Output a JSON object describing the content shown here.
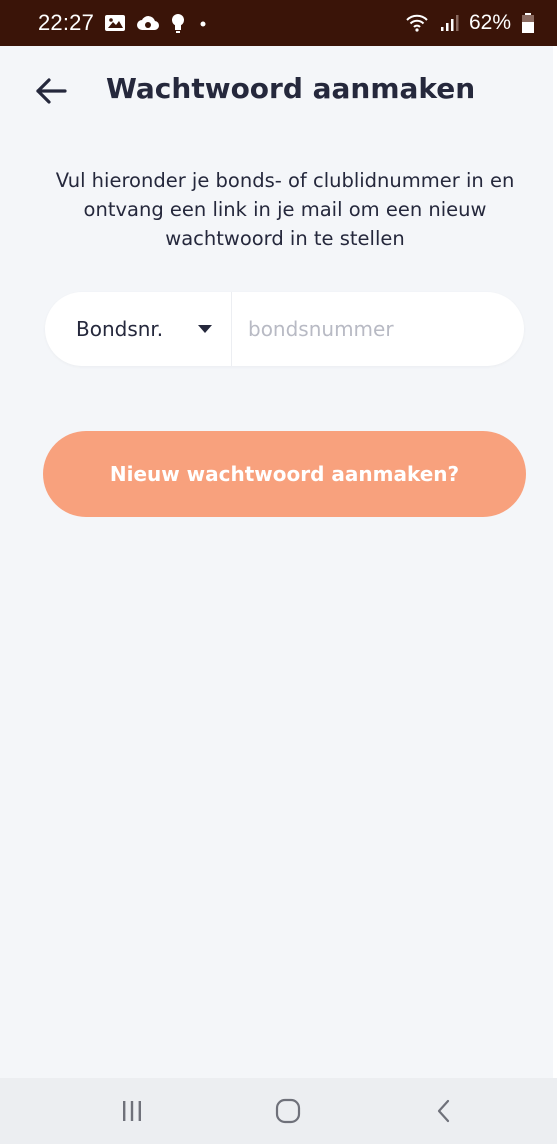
{
  "status_bar": {
    "time": "22:27",
    "battery_percent": "62%",
    "icons": [
      "gallery-icon",
      "cloud-icon",
      "bulb-icon",
      "dot-icon",
      "wifi-icon",
      "signal-icon",
      "battery-icon"
    ],
    "background_color": "#3a1408"
  },
  "header": {
    "title": "Wachtwoord aanmaken",
    "back_icon": "arrow-left-icon"
  },
  "instruction": {
    "text": "Vul hieronder je bonds- of clublidnummer in en ontvang een link in je mail om een nieuw wachtwoord in te stellen"
  },
  "form": {
    "select_value": "Bondsnr.",
    "input_placeholder": "bondsnummer",
    "input_value": ""
  },
  "submit": {
    "label": "Nieuw wachtwoord aanmaken?",
    "color": "#f8a17d"
  },
  "nav_bar": {
    "icons": [
      "recents-icon",
      "home-icon",
      "back-icon"
    ]
  },
  "colors": {
    "text": "#25283c",
    "background": "#f4f6f9",
    "placeholder": "#b8bac4"
  }
}
